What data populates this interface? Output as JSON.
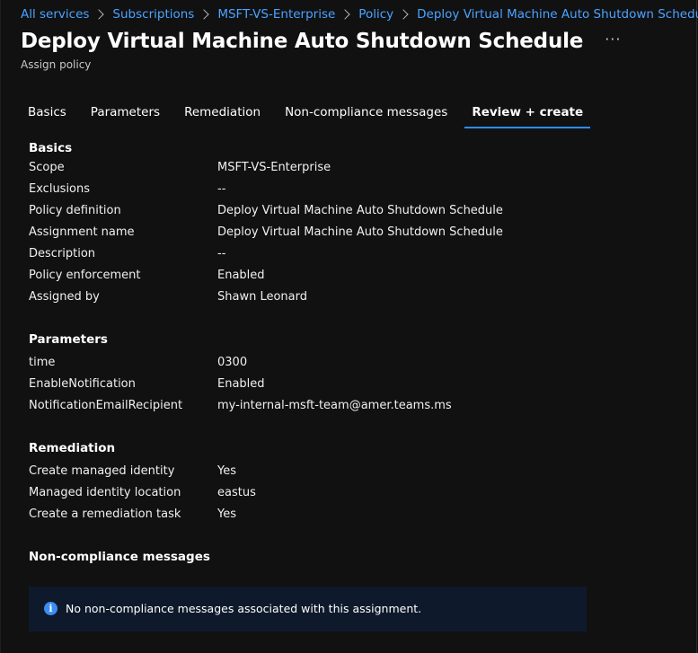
{
  "breadcrumb": [
    "All services",
    "Subscriptions",
    "MSFT-VS-Enterprise",
    "Policy",
    "Deploy Virtual Machine Auto Shutdown Schedule"
  ],
  "header": {
    "title": "Deploy Virtual Machine Auto Shutdown Schedule",
    "more": "···",
    "subtitle": "Assign policy"
  },
  "tabs": [
    "Basics",
    "Parameters",
    "Remediation",
    "Non-compliance messages",
    "Review + create"
  ],
  "active_tab": "Review + create",
  "basics": {
    "title": "Basics",
    "rows": [
      {
        "key": "Scope",
        "value": "MSFT-VS-Enterprise"
      },
      {
        "key": "Exclusions",
        "value": "--"
      },
      {
        "key": "Policy definition",
        "value": "Deploy Virtual Machine Auto Shutdown Schedule"
      },
      {
        "key": "Assignment name",
        "value": "Deploy Virtual Machine Auto Shutdown Schedule"
      },
      {
        "key": "Description",
        "value": "--"
      },
      {
        "key": "Policy enforcement",
        "value": "Enabled"
      },
      {
        "key": "Assigned by",
        "value": "Shawn Leonard"
      }
    ]
  },
  "parameters": {
    "title": "Parameters",
    "rows": [
      {
        "key": "time",
        "value": "0300"
      },
      {
        "key": "EnableNotification",
        "value": "Enabled"
      },
      {
        "key": "NotificationEmailRecipient",
        "value": "my-internal-msft-team@amer.teams.ms"
      }
    ]
  },
  "remediation": {
    "title": "Remediation",
    "rows": [
      {
        "key": "Create managed identity",
        "value": "Yes"
      },
      {
        "key": "Managed identity location",
        "value": "eastus"
      },
      {
        "key": "Create a remediation task",
        "value": "Yes"
      }
    ]
  },
  "noncompliance": {
    "title": "Non-compliance messages",
    "info_text": "No non-compliance messages associated with this assignment."
  },
  "colors": {
    "background": "#111112",
    "link": "#4aa3ff",
    "tab_underline": "#2f8cff",
    "info_bg": "#0e1a2b",
    "info_icon": "#3b8df5"
  },
  "icons": {
    "breadcrumb_separator": "chevron-right-icon",
    "info": "info-icon"
  }
}
